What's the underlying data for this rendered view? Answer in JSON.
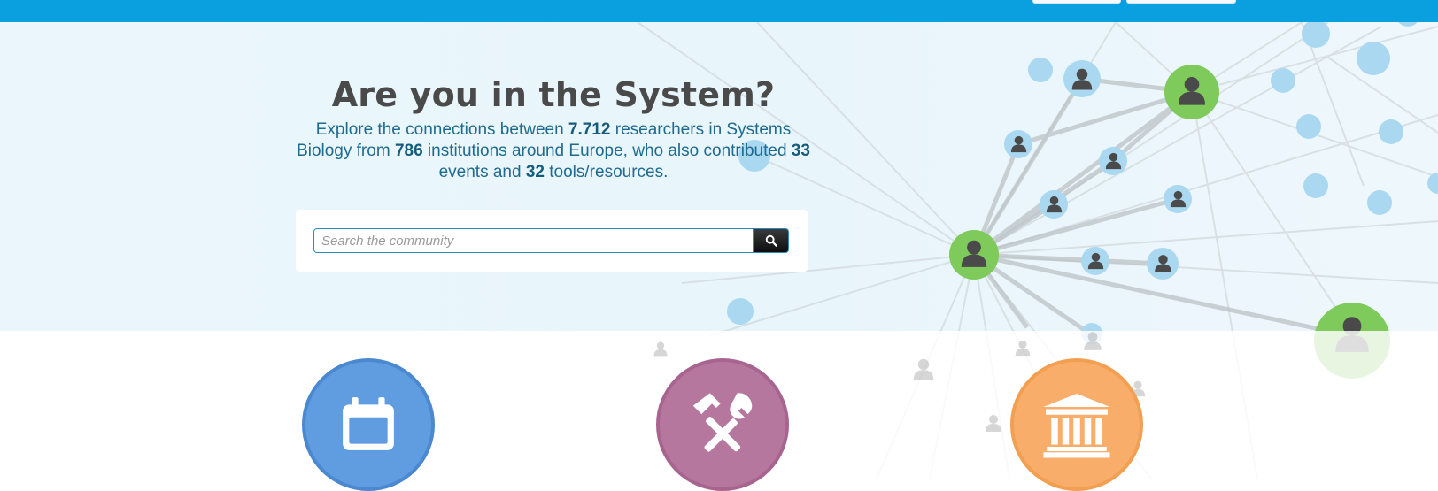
{
  "topbar": {
    "nav_buttons": [
      "",
      ""
    ]
  },
  "hero": {
    "title": "Are you in the System?",
    "lead": {
      "t1": "Explore the connections between ",
      "researchers": "7.712",
      "t2": " researchers in Systems Biology from ",
      "institutions": "786",
      "t3": " institutions around Europe, who also contributed ",
      "events": "33",
      "t4": " events and ",
      "tools": "32",
      "t5": " tools/resources."
    }
  },
  "search": {
    "placeholder": "Search the community"
  },
  "features": [
    {
      "name": "events",
      "icon": "calendar-icon",
      "color": "#5f9ce0"
    },
    {
      "name": "tools",
      "icon": "hammer-wrench-icon",
      "color": "#b6779f"
    },
    {
      "name": "institutions",
      "icon": "institution-building-icon",
      "color": "#f9ad6a"
    }
  ],
  "colors": {
    "topbar": "#0aa0df",
    "hero_bg": "#e8f5fb",
    "node_blue": "#a9d8f0",
    "node_green": "#7ecb5b"
  }
}
